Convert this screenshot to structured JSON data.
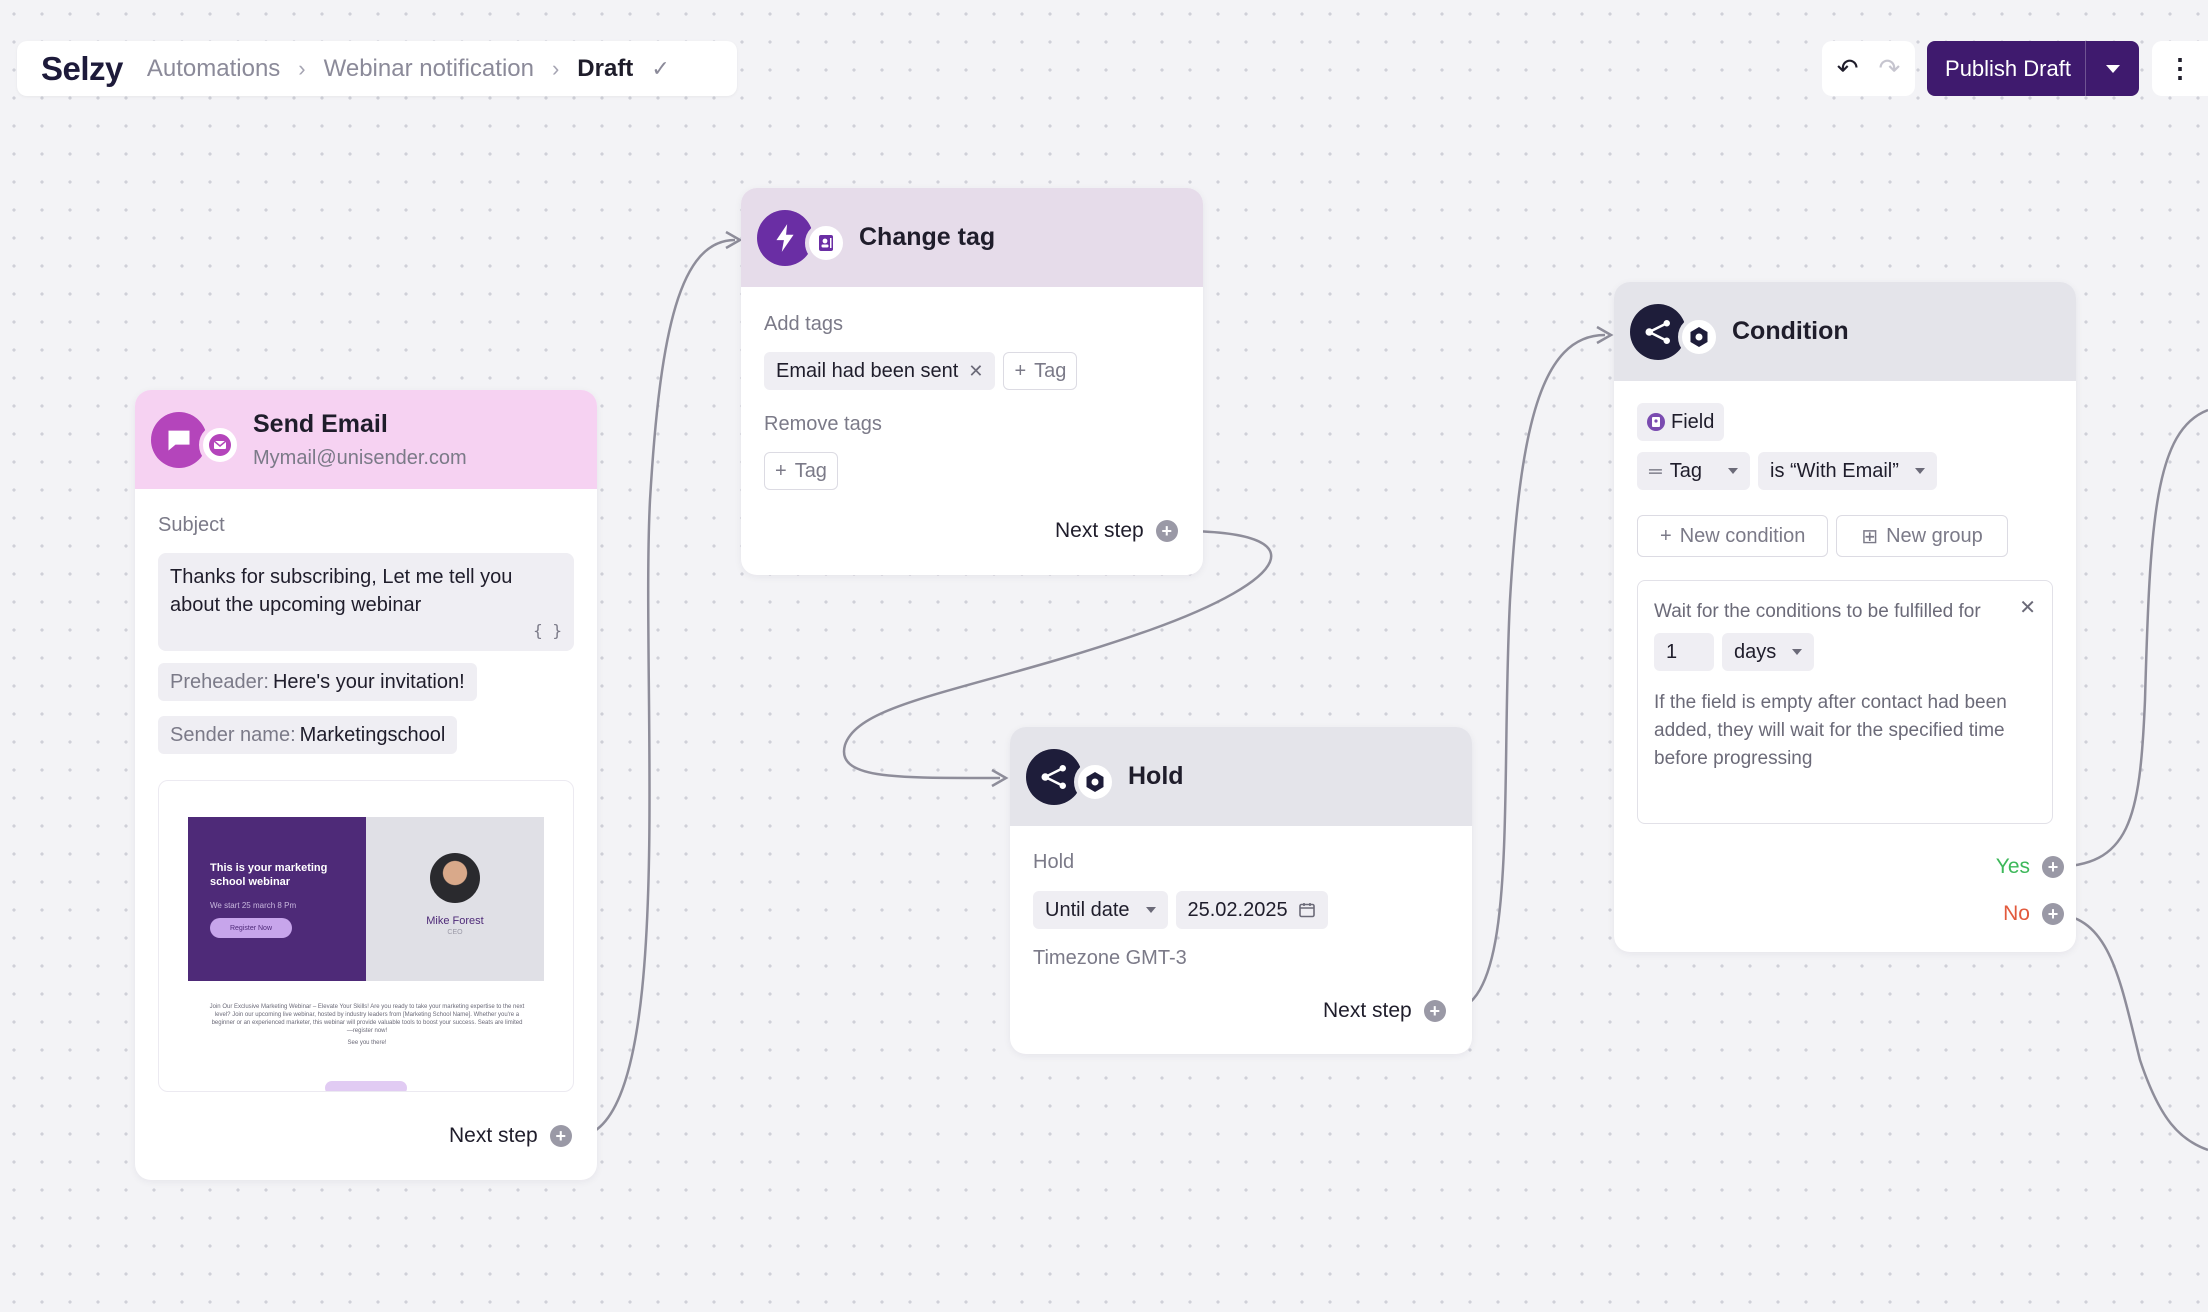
{
  "header": {
    "logo": "Selzy",
    "breadcrumb": [
      "Automations",
      "Webinar notification"
    ],
    "current": "Draft",
    "publish_label": "Publish Draft"
  },
  "nodes": {
    "send_email": {
      "title": "Send Email",
      "subtitle": "Mymail@unisender.com",
      "subject_label": "Subject",
      "subject": "Thanks for subscribing, Let me tell you about the upcoming webinar",
      "braces": "{ }",
      "preheader_label": "Preheader:",
      "preheader": "Here's your invitation!",
      "sender_label": "Sender name:",
      "sender": "Marketingschool",
      "preview": {
        "headline": "This is your marketing school webinar",
        "date": "We start 25 march 8 Pm",
        "button": "Register Now",
        "person": "Mike Forest",
        "role": "CEO",
        "body": "Join Our Exclusive Marketing Webinar – Elevate Your Skills! Are you ready to take your marketing expertise to the next level? Join our upcoming live webinar, hosted by industry leaders from [Marketing School Name]. Whether you're a beginner or an experienced marketer, this webinar will provide valuable tools to boost your success. Seats are limited—register now!",
        "signoff": "See you there!"
      },
      "next": "Next step"
    },
    "change_tag": {
      "title": "Change tag",
      "add_label": "Add tags",
      "tag": "Email had been sent",
      "tag_button": "Tag",
      "remove_label": "Remove tags",
      "next": "Next step"
    },
    "hold": {
      "title": "Hold",
      "label": "Hold",
      "mode": "Until date",
      "date": "25.02.2025",
      "timezone": "Timezone GMT-3",
      "next": "Next step"
    },
    "condition": {
      "title": "Condition",
      "field_label": "Field",
      "field": "Tag",
      "operator": "is “With Email”",
      "new_condition": "New condition",
      "new_group": "New group",
      "wait_text": "Wait for the conditions to be fulfilled for",
      "wait_value": "1",
      "wait_unit": "days",
      "hint": "If the field is empty after contact had been added, they will wait for the specified time before progressing",
      "yes": "Yes",
      "no": "No"
    }
  },
  "colors": {
    "publish": "#3f1a6e",
    "send_email_header": "#f6d2f2",
    "change_tag_header": "#e6dcea",
    "yes": "#3db85a",
    "no": "#e25a3d"
  }
}
